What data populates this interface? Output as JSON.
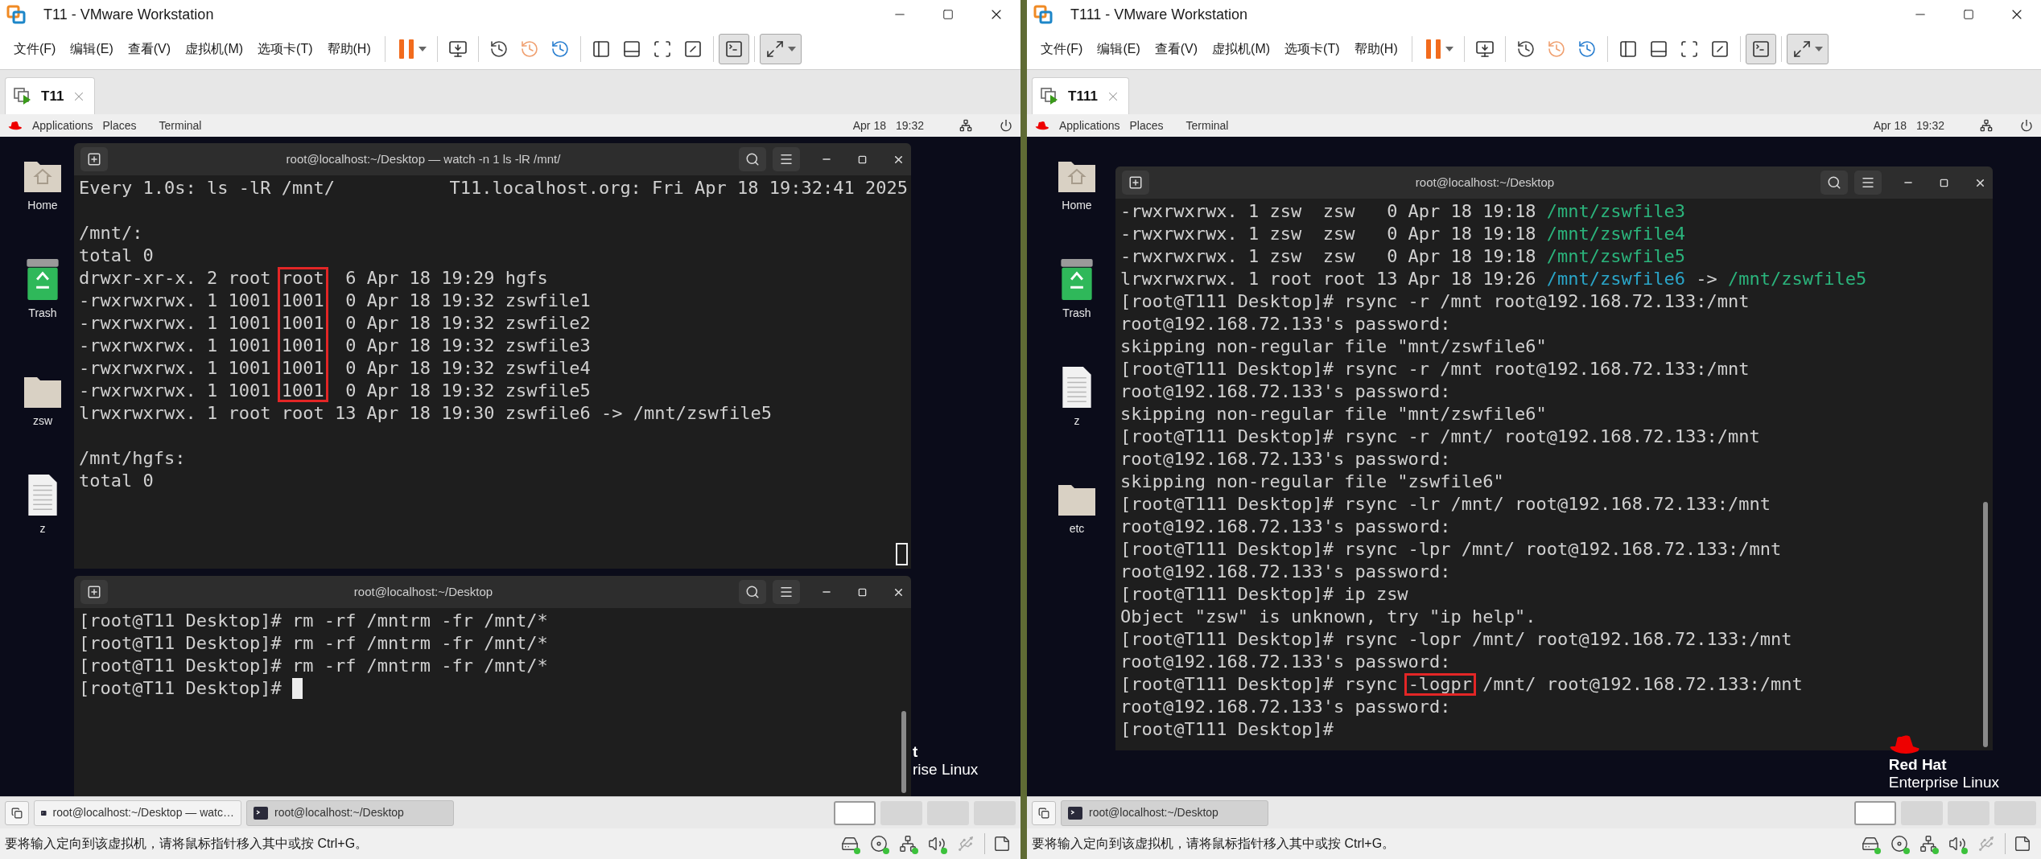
{
  "windows": [
    {
      "title": "T11 - VMware Workstation",
      "menu": [
        "文件(F)",
        "编辑(E)",
        "查看(V)",
        "虚拟机(M)",
        "选项卡(T)",
        "帮助(H)"
      ],
      "toolbar": [
        [
          {
            "kind": "pause",
            "pressed": false,
            "dropdown": true
          }
        ],
        [
          {
            "kind": "send-keys",
            "pressed": false,
            "dropdown": false
          }
        ],
        [
          {
            "kind": "snapshot-take",
            "pressed": false,
            "dropdown": false
          },
          {
            "kind": "snapshot-revert",
            "pressed": false,
            "dropdown": false
          },
          {
            "kind": "snapshot-manage",
            "pressed": false,
            "dropdown": false
          }
        ],
        [
          {
            "kind": "library",
            "pressed": false,
            "dropdown": false
          },
          {
            "kind": "thumbnails",
            "pressed": false,
            "dropdown": false
          },
          {
            "kind": "fit",
            "pressed": false,
            "dropdown": false
          },
          {
            "kind": "autofit",
            "pressed": false,
            "dropdown": false
          }
        ],
        [
          {
            "kind": "console",
            "pressed": true,
            "dropdown": false
          }
        ],
        [
          {
            "kind": "fullscreen",
            "pressed": true,
            "dropdown": true
          }
        ]
      ],
      "tab": "T11",
      "panel": {
        "menus": [
          "Applications",
          "Places",
          "Terminal"
        ],
        "date": "Apr 18",
        "time": "19:32"
      },
      "desktop_icons": [
        {
          "label": "Home",
          "kind": "home"
        },
        {
          "label": "Trash",
          "kind": "trash"
        },
        {
          "label": "zsw",
          "kind": "folder"
        },
        {
          "label": "z",
          "kind": "file"
        }
      ],
      "terminals": [
        {
          "title": "root@localhost:~/Desktop — watch -n 1 ls -lR /mnt/",
          "header": {
            "left": "Every 1.0s: ls -lR /mnt/",
            "right": "T11.localhost.org: Fri Apr 18 19:32:41 2025"
          },
          "cursor": {
            "kind": "hollow"
          },
          "lines": [
            {
              "kind": "blank"
            },
            {
              "kind": "text",
              "segments": [
                {
                  "text": "/mnt/:",
                  "kind": "plain"
                }
              ]
            },
            {
              "kind": "text",
              "segments": [
                {
                  "text": "total 0",
                  "kind": "plain"
                }
              ]
            },
            {
              "kind": "text",
              "segments": [
                {
                  "text": "drwxr-xr-x. 2 root ",
                  "kind": "plain"
                },
                {
                  "text": "root",
                  "kind": "plain",
                  "boxed": true
                },
                {
                  "text": "  6 Apr 18 19:29 hgfs",
                  "kind": "plain"
                }
              ]
            },
            {
              "kind": "text",
              "segments": [
                {
                  "text": "-rwxrwxrwx. 1 1001 ",
                  "kind": "plain"
                },
                {
                  "text": "1001",
                  "kind": "plain",
                  "boxed": true
                },
                {
                  "text": "  0 Apr 18 19:32 zswfile1",
                  "kind": "plain"
                }
              ]
            },
            {
              "kind": "text",
              "segments": [
                {
                  "text": "-rwxrwxrwx. 1 1001 ",
                  "kind": "plain"
                },
                {
                  "text": "1001",
                  "kind": "plain",
                  "boxed": true
                },
                {
                  "text": "  0 Apr 18 19:32 zswfile2",
                  "kind": "plain"
                }
              ]
            },
            {
              "kind": "text",
              "segments": [
                {
                  "text": "-rwxrwxrwx. 1 1001 ",
                  "kind": "plain"
                },
                {
                  "text": "1001",
                  "kind": "plain",
                  "boxed": true
                },
                {
                  "text": "  0 Apr 18 19:32 zswfile3",
                  "kind": "plain"
                }
              ]
            },
            {
              "kind": "text",
              "segments": [
                {
                  "text": "-rwxrwxrwx. 1 1001 ",
                  "kind": "plain"
                },
                {
                  "text": "1001",
                  "kind": "plain",
                  "boxed": true
                },
                {
                  "text": "  0 Apr 18 19:32 zswfile4",
                  "kind": "plain"
                }
              ]
            },
            {
              "kind": "text",
              "segments": [
                {
                  "text": "-rwxrwxrwx. 1 1001 ",
                  "kind": "plain"
                },
                {
                  "text": "1001",
                  "kind": "plain",
                  "boxed": true
                },
                {
                  "text": "  0 Apr 18 19:32 zswfile5",
                  "kind": "plain"
                }
              ]
            },
            {
              "kind": "text",
              "segments": [
                {
                  "text": "lrwxrwxrwx. 1 root root 13 Apr 18 19:30 zswfile6 -> /mnt/zswfile5",
                  "kind": "plain"
                }
              ]
            },
            {
              "kind": "blank"
            },
            {
              "kind": "text",
              "segments": [
                {
                  "text": "/mnt/hgfs:",
                  "kind": "plain"
                }
              ]
            },
            {
              "kind": "text",
              "segments": [
                {
                  "text": "total 0",
                  "kind": "plain"
                }
              ]
            }
          ]
        },
        {
          "title": "root@localhost:~/Desktop",
          "cursor": {
            "kind": "block"
          },
          "lines": [
            {
              "kind": "text",
              "segments": [
                {
                  "text": "[root@T11 Desktop]# rm -rf /mntrm -fr /mnt/*",
                  "kind": "plain"
                }
              ]
            },
            {
              "kind": "text",
              "segments": [
                {
                  "text": "[root@T11 Desktop]# rm -rf /mntrm -fr /mnt/*",
                  "kind": "plain"
                }
              ]
            },
            {
              "kind": "text",
              "segments": [
                {
                  "text": "[root@T11 Desktop]# rm -rf /mntrm -fr /mnt/*",
                  "kind": "plain"
                }
              ]
            },
            {
              "kind": "text",
              "segments": [
                {
                  "text": "[root@T11 Desktop]#",
                  "kind": "plain"
                }
              ]
            }
          ]
        }
      ],
      "brand": {
        "icon": false,
        "lines": [
          "t",
          "rise Linux"
        ]
      },
      "taskbar": [
        {
          "label": "root@localhost:~/Desktop — watc…",
          "selected": false
        },
        {
          "label": "root@localhost:~/Desktop",
          "selected": true
        }
      ],
      "workspaces": [
        {
          "selected": true
        },
        {
          "selected": false
        },
        {
          "selected": false
        },
        {
          "selected": false
        }
      ],
      "status": "要将输入定向到该虚拟机，请将鼠标指针移入其中或按 Ctrl+G。",
      "devices": [
        {
          "kind": "hdd",
          "connected": true
        },
        {
          "kind": "cd",
          "connected": true
        },
        {
          "kind": "network",
          "connected": true
        },
        {
          "kind": "sound",
          "connected": true
        },
        {
          "kind": "usb",
          "connected": false
        }
      ]
    },
    {
      "title": "T111 - VMware Workstation",
      "menu": [
        "文件(F)",
        "编辑(E)",
        "查看(V)",
        "虚拟机(M)",
        "选项卡(T)",
        "帮助(H)"
      ],
      "toolbar": [
        [
          {
            "kind": "pause",
            "pressed": false,
            "dropdown": true
          }
        ],
        [
          {
            "kind": "send-keys",
            "pressed": false,
            "dropdown": false
          }
        ],
        [
          {
            "kind": "snapshot-take",
            "pressed": false,
            "dropdown": false
          },
          {
            "kind": "snapshot-revert",
            "pressed": false,
            "dropdown": false
          },
          {
            "kind": "snapshot-manage",
            "pressed": false,
            "dropdown": false
          }
        ],
        [
          {
            "kind": "library",
            "pressed": false,
            "dropdown": false
          },
          {
            "kind": "thumbnails",
            "pressed": false,
            "dropdown": false
          },
          {
            "kind": "fit",
            "pressed": false,
            "dropdown": false
          },
          {
            "kind": "autofit",
            "pressed": false,
            "dropdown": false
          }
        ],
        [
          {
            "kind": "console",
            "pressed": true,
            "dropdown": false
          }
        ],
        [
          {
            "kind": "fullscreen",
            "pressed": true,
            "dropdown": true
          }
        ]
      ],
      "tab": "T111",
      "panel": {
        "menus": [
          "Applications",
          "Places",
          "Terminal"
        ],
        "date": "Apr 18",
        "time": "19:32"
      },
      "desktop_icons": [
        {
          "label": "Home",
          "kind": "home"
        },
        {
          "label": "Trash",
          "kind": "trash"
        },
        {
          "label": "z",
          "kind": "file"
        },
        {
          "label": "etc",
          "kind": "folder"
        }
      ],
      "terminals": [
        {
          "title": "root@localhost:~/Desktop",
          "lines": [
            {
              "kind": "text",
              "segments": [
                {
                  "text": "-rwxrwxrwx. 1 zsw  zsw   0 Apr 18 19:18 ",
                  "kind": "plain"
                },
                {
                  "text": "/mnt/zswfile3",
                  "kind": "executable"
                }
              ]
            },
            {
              "kind": "text",
              "segments": [
                {
                  "text": "-rwxrwxrwx. 1 zsw  zsw   0 Apr 18 19:18 ",
                  "kind": "plain"
                },
                {
                  "text": "/mnt/zswfile4",
                  "kind": "executable"
                }
              ]
            },
            {
              "kind": "text",
              "segments": [
                {
                  "text": "-rwxrwxrwx. 1 zsw  zsw   0 Apr 18 19:18 ",
                  "kind": "plain"
                },
                {
                  "text": "/mnt/zswfile5",
                  "kind": "executable"
                }
              ]
            },
            {
              "kind": "text",
              "segments": [
                {
                  "text": "lrwxrwxrwx. 1 root root 13 Apr 18 19:26 ",
                  "kind": "plain"
                },
                {
                  "text": "/mnt/zswfile6",
                  "kind": "symlink"
                },
                {
                  "text": " -> ",
                  "kind": "plain"
                },
                {
                  "text": "/mnt/zswfile5",
                  "kind": "executable"
                }
              ]
            },
            {
              "kind": "text",
              "segments": [
                {
                  "text": "[root@T111 Desktop]# rsync -r /mnt root@192.168.72.133:/mnt",
                  "kind": "plain"
                }
              ]
            },
            {
              "kind": "text",
              "segments": [
                {
                  "text": "root@192.168.72.133's password:",
                  "kind": "plain"
                }
              ]
            },
            {
              "kind": "text",
              "segments": [
                {
                  "text": "skipping non-regular file \"mnt/zswfile6\"",
                  "kind": "plain"
                }
              ]
            },
            {
              "kind": "text",
              "segments": [
                {
                  "text": "[root@T111 Desktop]# rsync -r /mnt root@192.168.72.133:/mnt",
                  "kind": "plain"
                }
              ]
            },
            {
              "kind": "text",
              "segments": [
                {
                  "text": "root@192.168.72.133's password:",
                  "kind": "plain"
                }
              ]
            },
            {
              "kind": "text",
              "segments": [
                {
                  "text": "skipping non-regular file \"mnt/zswfile6\"",
                  "kind": "plain"
                }
              ]
            },
            {
              "kind": "text",
              "segments": [
                {
                  "text": "[root@T111 Desktop]# rsync -r /mnt/ root@192.168.72.133:/mnt",
                  "kind": "plain"
                }
              ]
            },
            {
              "kind": "text",
              "segments": [
                {
                  "text": "root@192.168.72.133's password:",
                  "kind": "plain"
                }
              ]
            },
            {
              "kind": "text",
              "segments": [
                {
                  "text": "skipping non-regular file \"zswfile6\"",
                  "kind": "plain"
                }
              ]
            },
            {
              "kind": "text",
              "segments": [
                {
                  "text": "[root@T111 Desktop]# rsync -lr /mnt/ root@192.168.72.133:/mnt",
                  "kind": "plain"
                }
              ]
            },
            {
              "kind": "text",
              "segments": [
                {
                  "text": "root@192.168.72.133's password:",
                  "kind": "plain"
                }
              ]
            },
            {
              "kind": "text",
              "segments": [
                {
                  "text": "[root@T111 Desktop]# rsync -lpr /mnt/ root@192.168.72.133:/mnt",
                  "kind": "plain"
                }
              ]
            },
            {
              "kind": "text",
              "segments": [
                {
                  "text": "root@192.168.72.133's password:",
                  "kind": "plain"
                }
              ]
            },
            {
              "kind": "text",
              "segments": [
                {
                  "text": "[root@T111 Desktop]# ip zsw",
                  "kind": "plain"
                }
              ]
            },
            {
              "kind": "text",
              "segments": [
                {
                  "text": "Object \"zsw\" is unknown, try \"ip help\".",
                  "kind": "plain"
                }
              ]
            },
            {
              "kind": "text",
              "segments": [
                {
                  "text": "[root@T111 Desktop]# rsync -lopr /mnt/ root@192.168.72.133:/mnt",
                  "kind": "plain"
                }
              ]
            },
            {
              "kind": "text",
              "segments": [
                {
                  "text": "root@192.168.72.133's password:",
                  "kind": "plain"
                }
              ]
            },
            {
              "kind": "text",
              "segments": [
                {
                  "text": "[root@T111 Desktop]# rsync ",
                  "kind": "plain"
                },
                {
                  "text": "-logpr",
                  "kind": "plain",
                  "boxed": true
                },
                {
                  "text": " /mnt/ root@192.168.72.133:/mnt",
                  "kind": "plain"
                }
              ]
            },
            {
              "kind": "text",
              "segments": [
                {
                  "text": "root@192.168.72.133's password:",
                  "kind": "plain"
                }
              ]
            },
            {
              "kind": "text",
              "segments": [
                {
                  "text": "[root@T111 Desktop]#",
                  "kind": "plain"
                }
              ]
            }
          ]
        }
      ],
      "brand": {
        "icon": true,
        "lines": [
          "Red Hat",
          "Enterprise Linux"
        ]
      },
      "taskbar": [
        {
          "label": "root@localhost:~/Desktop",
          "selected": true
        }
      ],
      "workspaces": [
        {
          "selected": true
        },
        {
          "selected": false
        },
        {
          "selected": false
        },
        {
          "selected": false
        }
      ],
      "status": "要将输入定向到该虚拟机，请将鼠标指针移入其中或按 Ctrl+G。",
      "devices": [
        {
          "kind": "hdd",
          "connected": true
        },
        {
          "kind": "cd",
          "connected": true
        },
        {
          "kind": "network",
          "connected": true
        },
        {
          "kind": "sound",
          "connected": true
        },
        {
          "kind": "usb",
          "connected": false
        }
      ]
    }
  ]
}
